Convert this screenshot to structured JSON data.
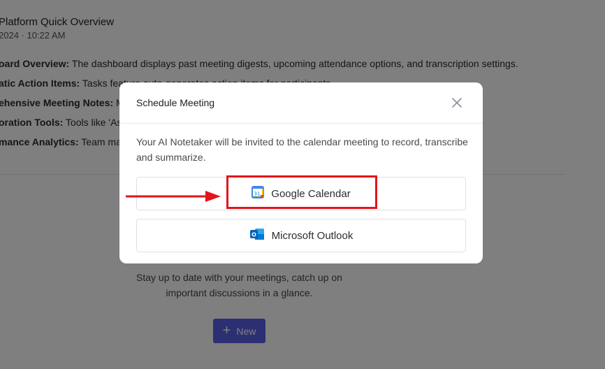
{
  "background": {
    "title": "Platform Quick Overview",
    "date": "2024 · 10:22 AM",
    "items": [
      {
        "label": "oard Overview:",
        "text": " The dashboard displays past meeting digests, upcoming attendance options, and transcription settings."
      },
      {
        "label": "atic Action Items:",
        "text": " Tasks feature auto-generates action items for participants."
      },
      {
        "label": "ehensive Meeting Notes:",
        "text": " Me"
      },
      {
        "label": "oration Tools:",
        "text": " Tools like 'Ask"
      },
      {
        "label": "mance Analytics:",
        "text": " Team man"
      }
    ],
    "empty_message": "Stay up to date with your meetings, catch up on important discussions in a glance.",
    "new_button": "New"
  },
  "modal": {
    "title": "Schedule Meeting",
    "description": "Your AI Notetaker will be invited to the calendar meeting to record, transcribe and summarize.",
    "options": [
      {
        "label": "Google Calendar",
        "icon": "google-calendar-icon",
        "icon_text": "31"
      },
      {
        "label": "Microsoft Outlook",
        "icon": "microsoft-outlook-icon",
        "icon_text": "O"
      }
    ]
  },
  "colors": {
    "accent": "#5b5fe6",
    "highlight": "#e3141b",
    "overlay": "rgba(0,0,0,0.5)"
  }
}
